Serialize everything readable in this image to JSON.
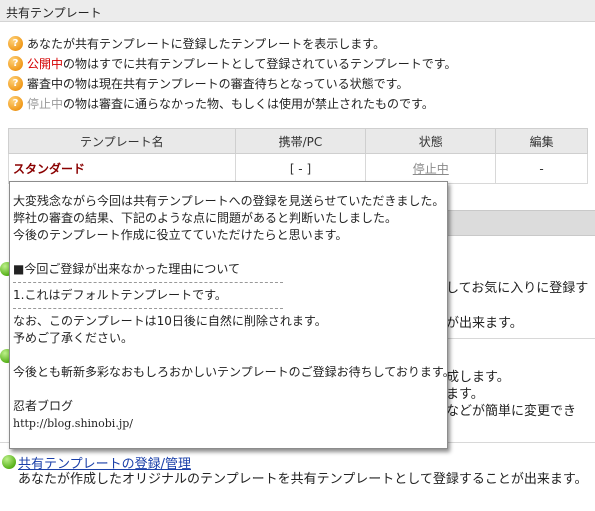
{
  "header": {
    "title": "共有テンプレート"
  },
  "info": {
    "lines": [
      {
        "pre": "",
        "hl": "",
        "post": "あなたが共有テンプレートに登録したテンプレートを表示します。"
      },
      {
        "pre": "",
        "hl": "公開中",
        "post": "の物はすでに共有テンプレートとして登録されているテンプレートです。"
      },
      {
        "pre": "審査中の物は現在共有テンプレートの審査待ちとなっている状態です。",
        "hl": "",
        "post": ""
      },
      {
        "pre": "",
        "hl": "停止中",
        "post": "の物は審査に通らなかった物、もしくは使用が禁止されたものです。"
      }
    ]
  },
  "table": {
    "headers": [
      "テンプレート名",
      "携帯/PC",
      "状態",
      "編集"
    ],
    "rows": [
      {
        "name": "スタンダード",
        "device": "[ - ]",
        "status": "停止中",
        "edit": "-"
      }
    ]
  },
  "background": {
    "fragments": [
      "してお気に入りに登録す",
      "が出来ます。",
      "成します。",
      "ます。",
      "などが簡単に変更でき"
    ]
  },
  "popup": {
    "lines": [
      "大変残念ながら今回は共有テンプレートへの登録を見送らせていただきました。",
      "弊社の審査の結果、下記のような点に問題があると判断いたしました。",
      "今後のテンプレート作成に役立てていただけたらと思います。",
      "■今回ご登録が出来なかった理由について",
      "1.これはデフォルトテンプレートです。",
      "なお、このテンプレートは10日後に自然に削除されます。",
      "予めご了承ください。",
      "今後とも斬新多彩なおもしろおかしいテンプレートのご登録お待ちしております。",
      "忍者ブログ",
      "http://blog.shinobi.jp/"
    ]
  },
  "bottom": {
    "link": "共有テンプレートの登録/管理",
    "text": "あなたが作成したオリジナルのテンプレートを共有テンプレートとして登録することが出来ます。"
  },
  "colors": {
    "highlight_red": "#d40000",
    "highlight_gray": "#9a9a9a",
    "link": "#1a3fa8",
    "name": "#8a0000"
  }
}
